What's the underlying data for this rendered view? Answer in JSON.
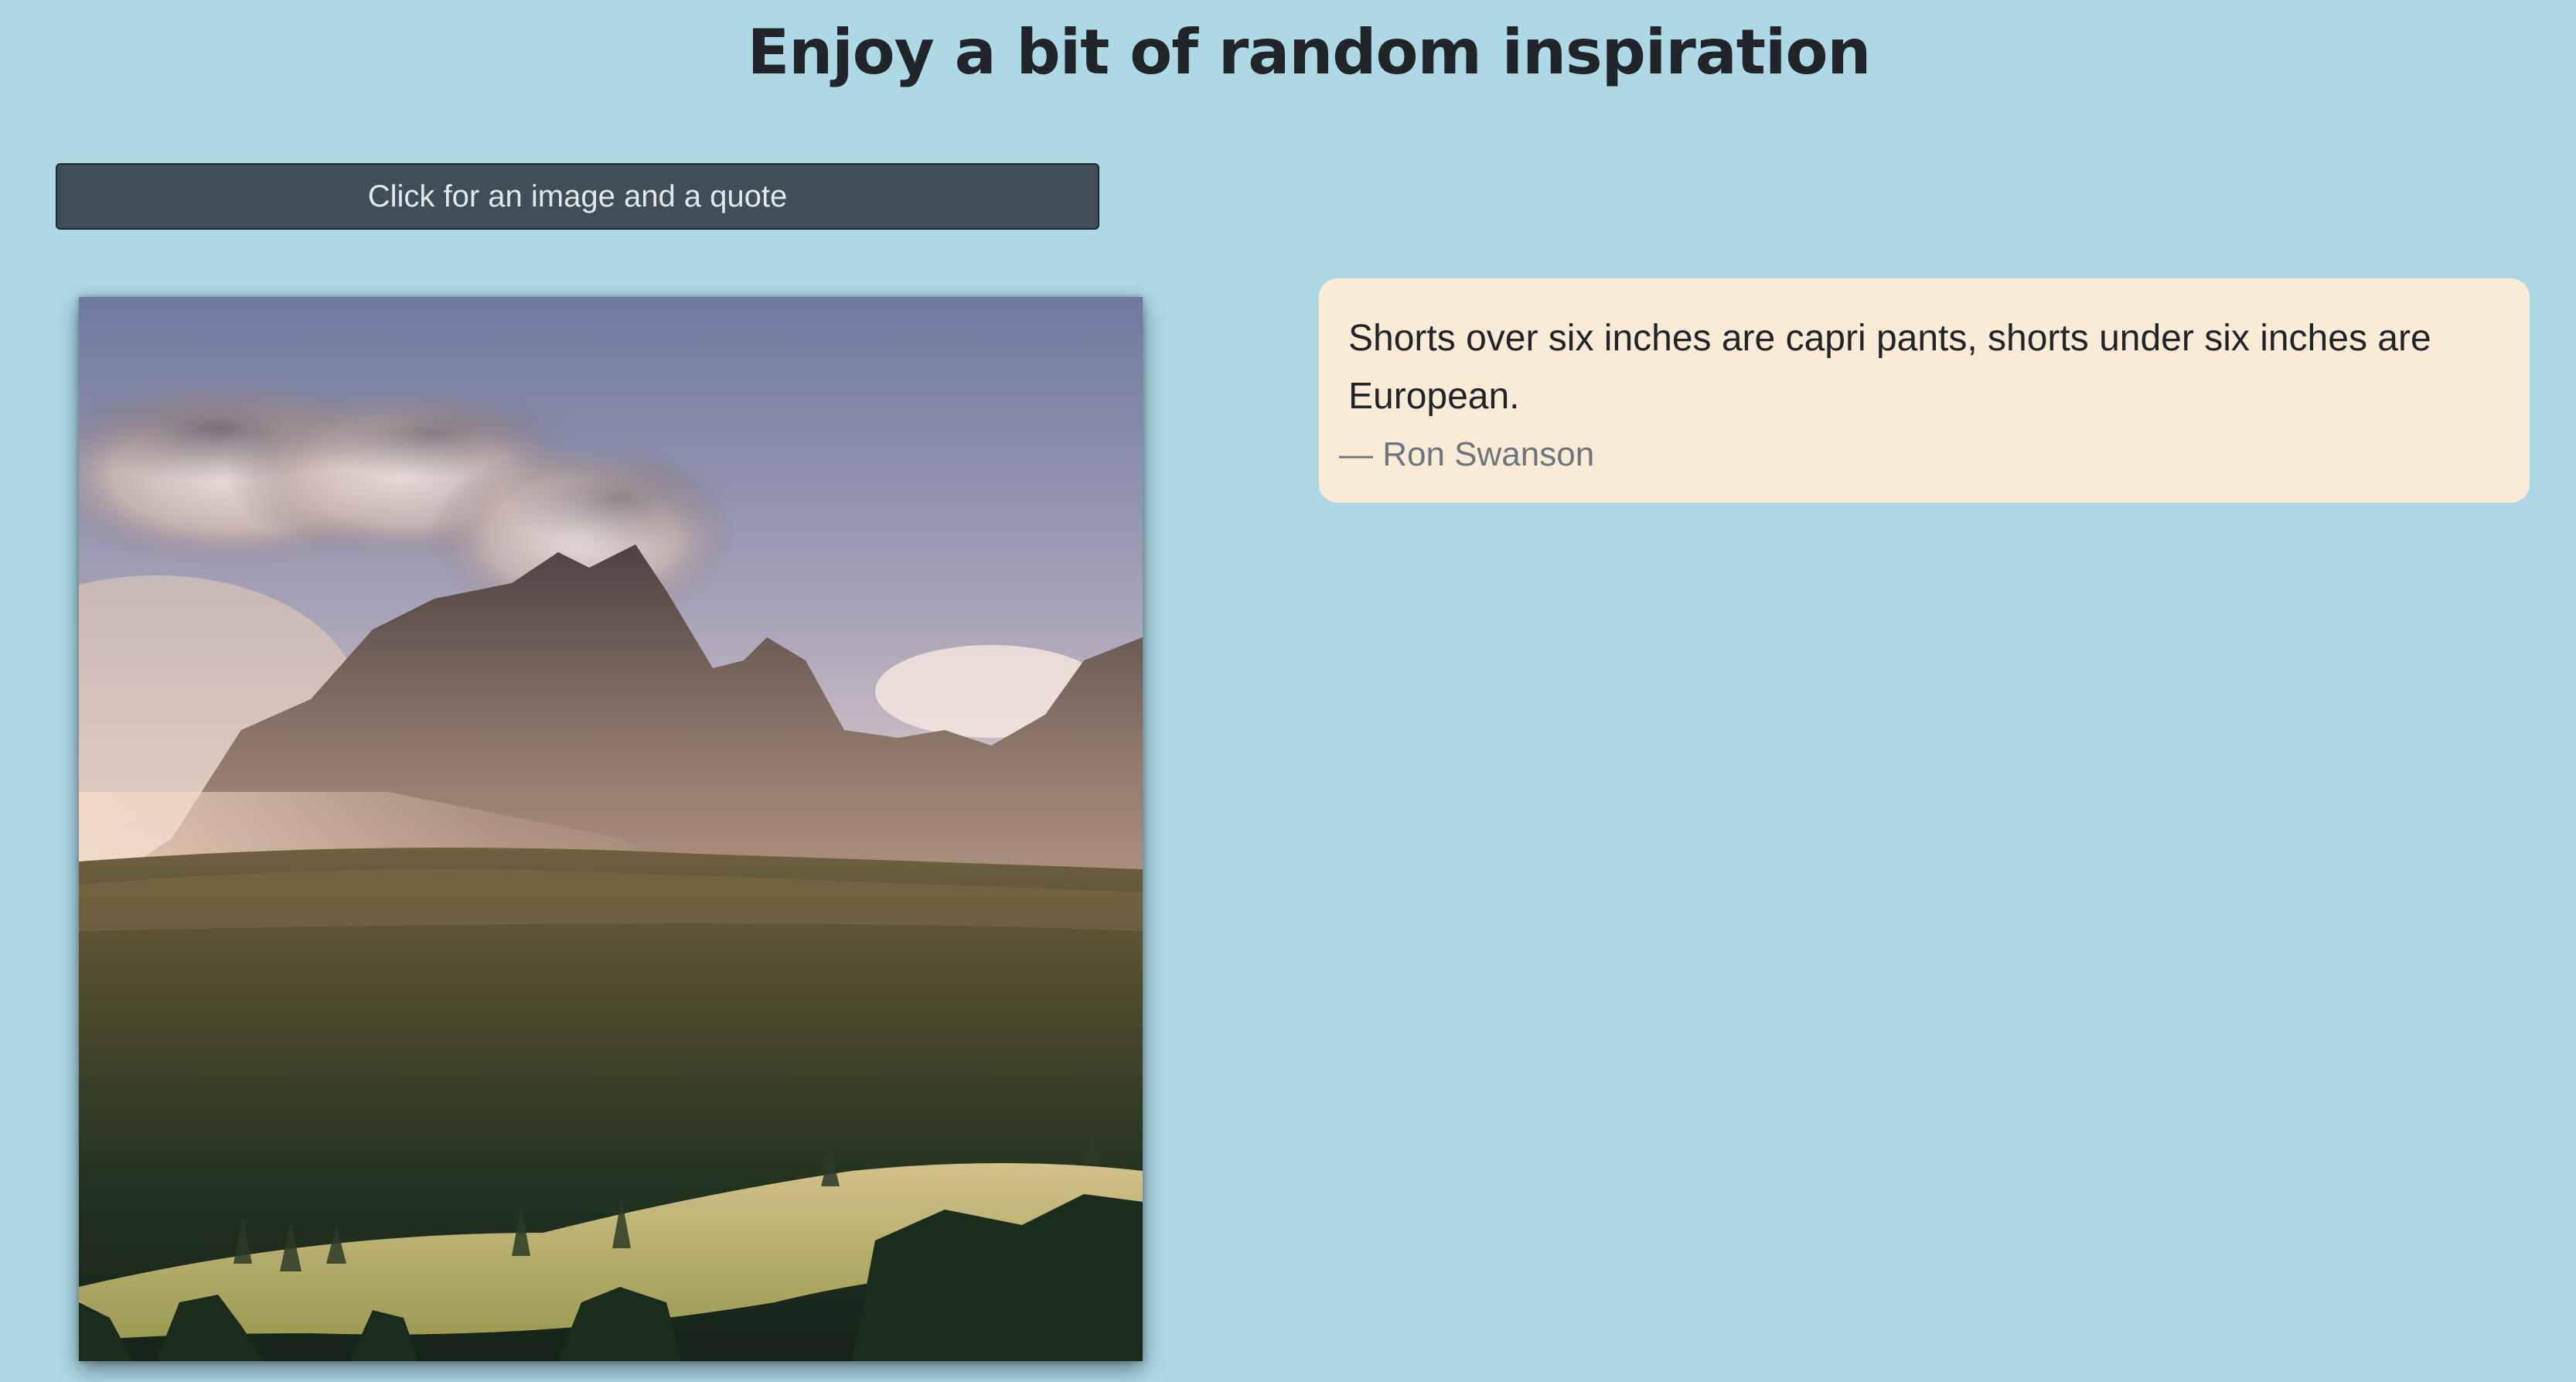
{
  "header": {
    "title": "Enjoy a bit of random inspiration"
  },
  "controls": {
    "button_label": "Click for an image and a quote"
  },
  "quote": {
    "text": "Shorts over six inches are capri pants, shorts under six inches are European.",
    "author": "— Ron Swanson"
  },
  "image": {
    "alt": "Mountain landscape with clouds, forest and meadow"
  },
  "colors": {
    "background": "#add8e6",
    "button_bg": "#3f4e58",
    "quote_bg": "#faebd7",
    "title": "#212529",
    "author": "#6c757d"
  }
}
